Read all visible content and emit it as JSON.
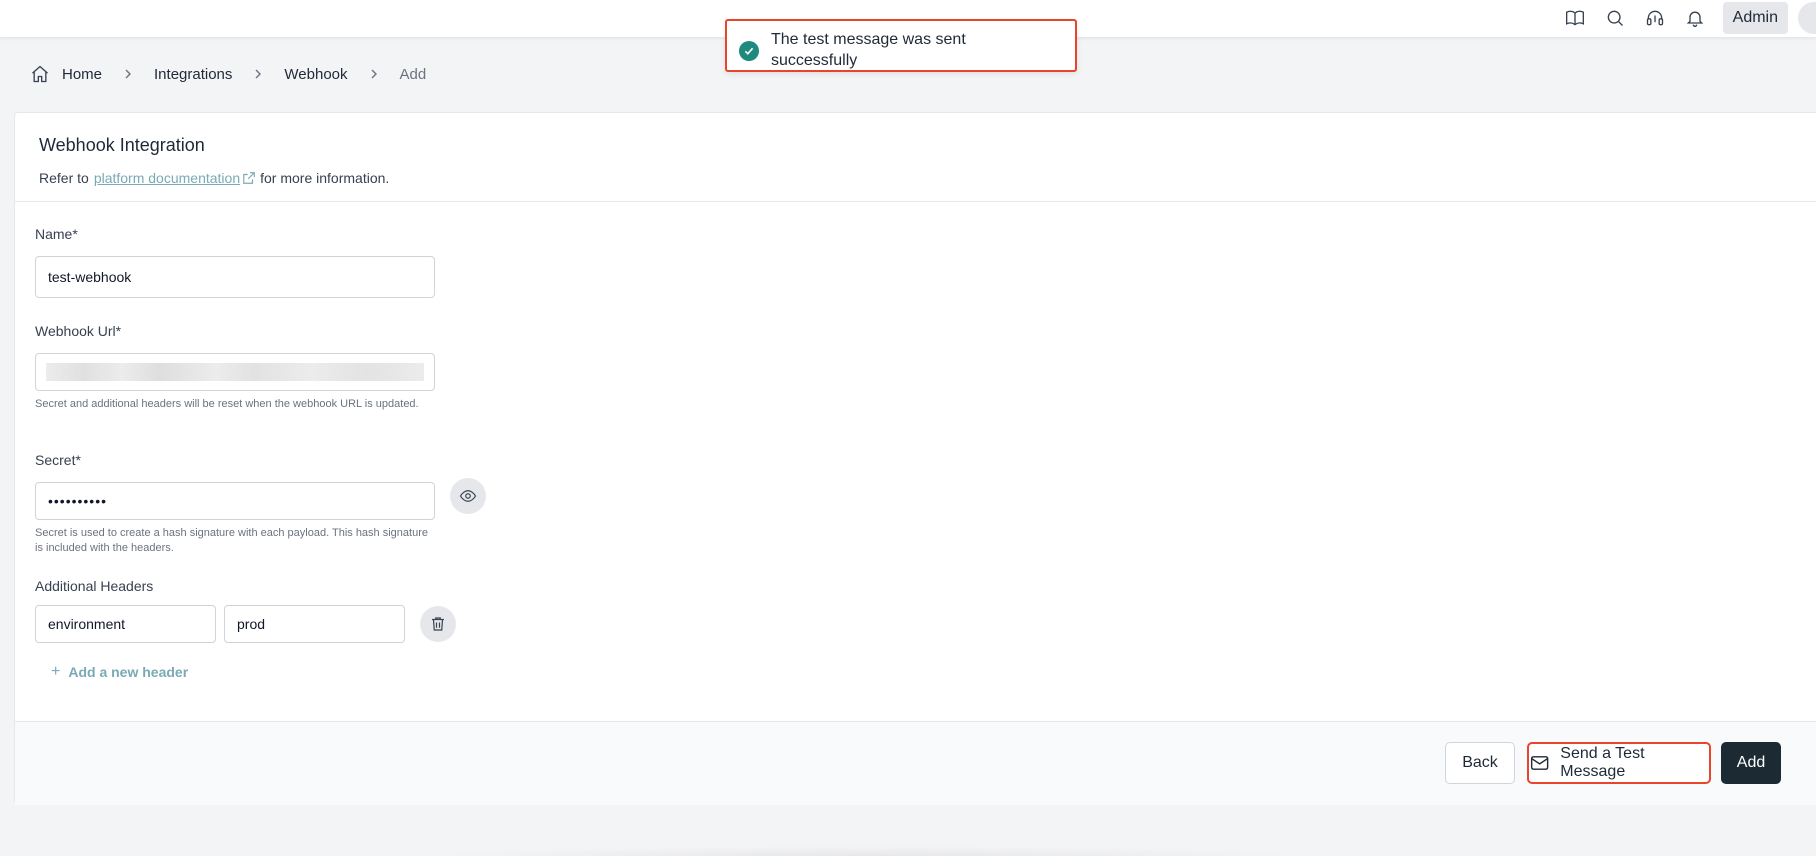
{
  "topbar": {
    "icons": [
      "book-icon",
      "search-icon",
      "headset-icon",
      "bell-icon"
    ],
    "admin_label": "Admin"
  },
  "toast": {
    "message": "The test message was sent successfully",
    "status_color": "#1e8a7e",
    "highlight_color": "#e8452c"
  },
  "breadcrumb": {
    "items": [
      "Home",
      "Integrations",
      "Webhook",
      "Add"
    ]
  },
  "card": {
    "title": "Webhook Integration",
    "sub_prefix": "Refer to",
    "doc_link": "platform documentation",
    "sub_suffix": "for more information."
  },
  "form": {
    "name_label": "Name*",
    "name_value": "test-webhook",
    "url_label": "Webhook Url*",
    "url_help": "Secret and additional headers will be reset when the webhook URL is updated.",
    "secret_label": "Secret*",
    "secret_value": "••••••••••",
    "secret_help": "Secret is used to create a hash signature with each payload. This hash signature is included with the headers.",
    "headers_label": "Additional Headers",
    "header_key": "environment",
    "header_value": "prod",
    "add_header": "Add a new header"
  },
  "footer": {
    "back": "Back",
    "send_test": "Send a Test Message",
    "add": "Add",
    "primary_color": "#1c2b33",
    "link_color": "#7aaab5"
  }
}
